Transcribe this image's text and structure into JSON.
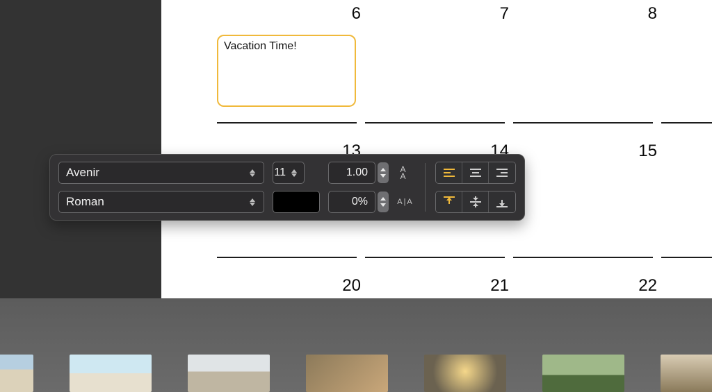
{
  "calendar": {
    "event_text": "Vacation Time!",
    "rows": [
      {
        "days": [
          "6",
          "7",
          "8"
        ]
      },
      {
        "days": [
          "13",
          "14",
          "15"
        ]
      },
      {
        "days": [
          "20",
          "21",
          "22"
        ]
      }
    ]
  },
  "toolbar": {
    "font_family": "Avenir",
    "font_style": "Roman",
    "font_size": "11",
    "line_spacing": "1.00",
    "tracking": "0%",
    "text_color": "#000000",
    "line_spacing_icon": "A\nA",
    "tracking_icon": "A|A",
    "h_align_active": "left",
    "v_align_active": "top"
  }
}
